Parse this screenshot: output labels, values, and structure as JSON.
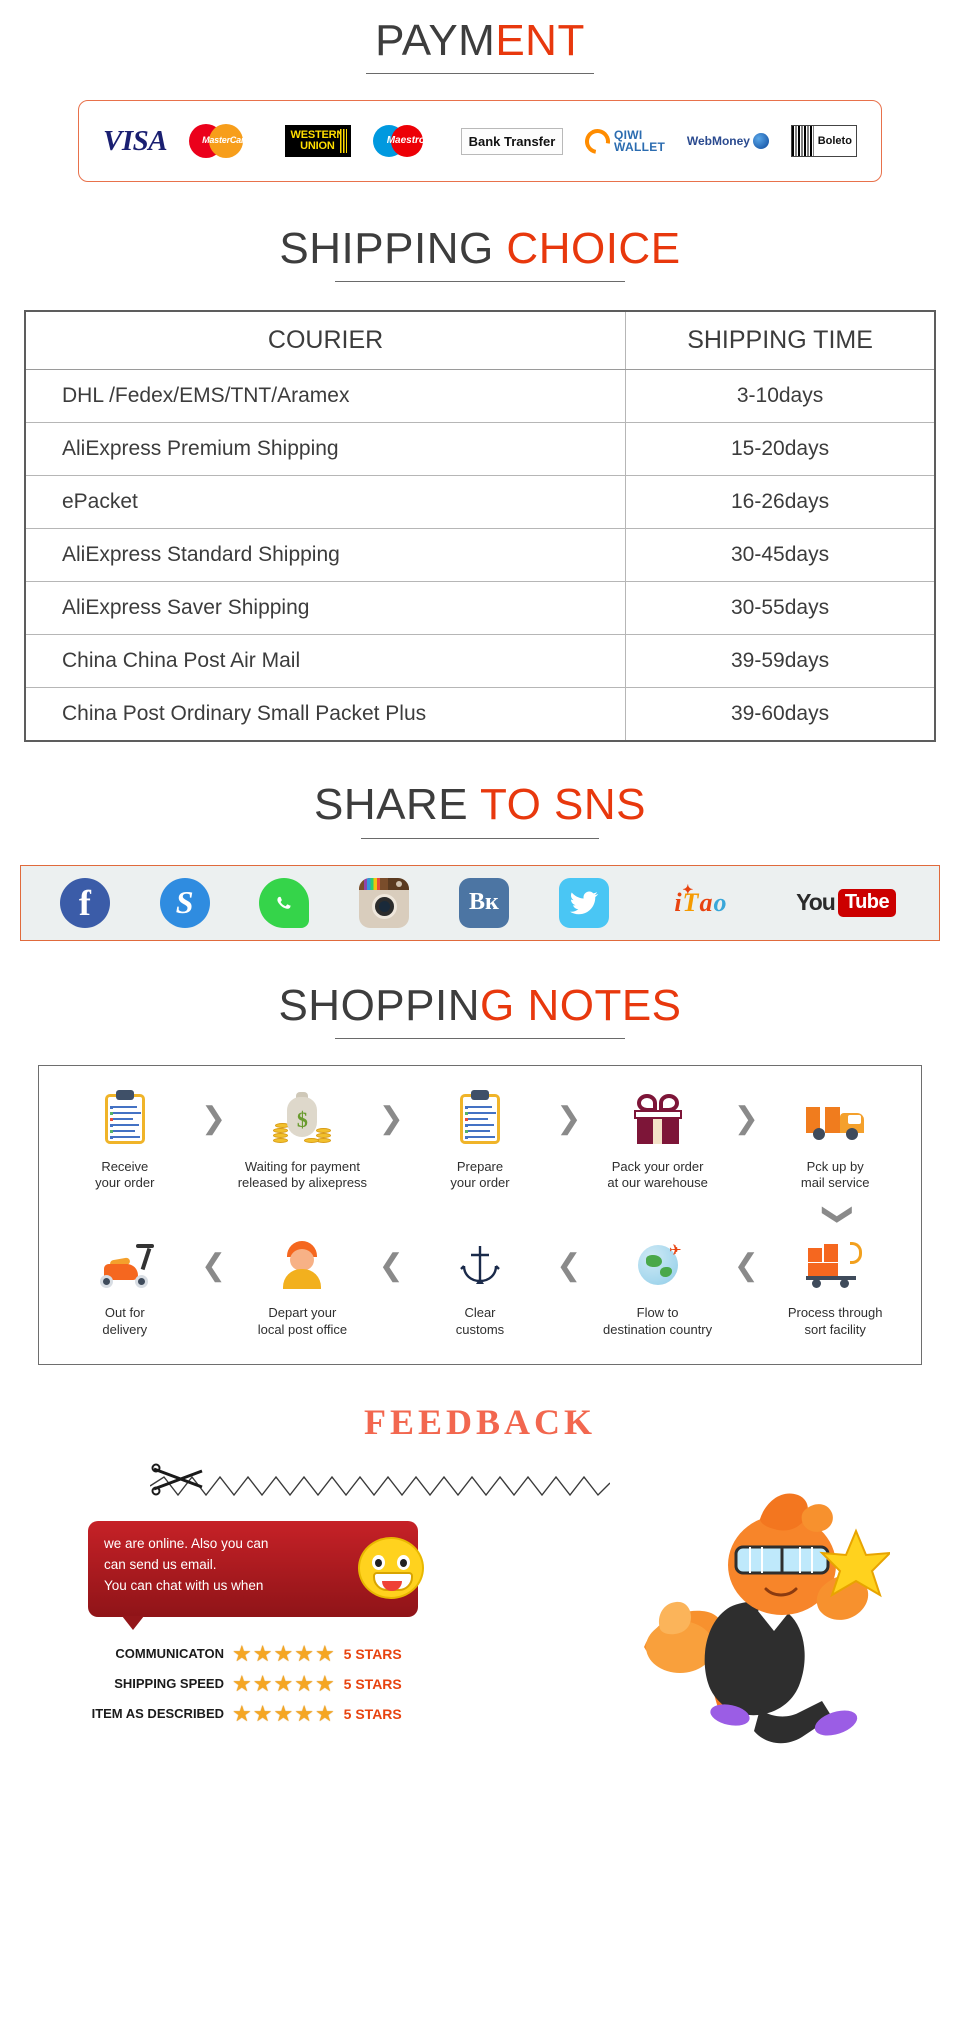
{
  "payment": {
    "heading_dark": "PAYM",
    "heading_red": "ENT",
    "methods": [
      {
        "name": "visa",
        "label": "VISA"
      },
      {
        "name": "mastercard",
        "label": "MasterCard"
      },
      {
        "name": "western-union",
        "label_line1": "WESTERN",
        "label_line2": "UNION"
      },
      {
        "name": "maestro",
        "label": "Maestro"
      },
      {
        "name": "bank-transfer",
        "label": "Bank Transfer"
      },
      {
        "name": "qiwi-wallet",
        "label_line1": "QIWI",
        "label_line2": "WALLET"
      },
      {
        "name": "webmoney",
        "label": "WebMoney"
      },
      {
        "name": "boleto",
        "label": "Boleto"
      }
    ]
  },
  "shipping": {
    "heading_dark": "SHIPPING",
    "heading_red": " CHOICE",
    "columns": [
      "COURIER",
      "SHIPPING TIME"
    ],
    "rows": [
      {
        "courier": "DHL /Fedex/EMS/TNT/Aramex",
        "time": "3-10days"
      },
      {
        "courier": "AliExpress Premium Shipping",
        "time": "15-20days"
      },
      {
        "courier": "ePacket",
        "time": "16-26days"
      },
      {
        "courier": "AliExpress Standard Shipping",
        "time": "30-45days"
      },
      {
        "courier": "AliExpress Saver Shipping",
        "time": "30-55days"
      },
      {
        "courier": "China China Post Air Mail",
        "time": "39-59days"
      },
      {
        "courier": "China Post Ordinary Small Packet Plus",
        "time": "39-60days"
      }
    ]
  },
  "sns": {
    "heading_dark": "SHARE",
    "heading_red": " TO SNS",
    "networks": [
      {
        "name": "facebook",
        "label": "f"
      },
      {
        "name": "skype",
        "label": "S"
      },
      {
        "name": "whatsapp",
        "label": "WhatsApp"
      },
      {
        "name": "instagram",
        "label": "Instagram"
      },
      {
        "name": "vk",
        "label": "VK"
      },
      {
        "name": "twitter",
        "label": "Twitter"
      },
      {
        "name": "itao",
        "label": "iTao"
      },
      {
        "name": "youtube",
        "label_text": "You",
        "label_box": "Tube"
      }
    ]
  },
  "notes": {
    "heading_dark": "SHOPPIN",
    "heading_red": "G NOTES",
    "row1": [
      {
        "icon": "clipboard-icon",
        "line1": "Receive",
        "line2": "your order"
      },
      {
        "icon": "money-bag-icon",
        "line1": "Waiting for payment",
        "line2": "released by alixepress"
      },
      {
        "icon": "clipboard-icon",
        "line1": "Prepare",
        "line2": "your order"
      },
      {
        "icon": "gift-box-icon",
        "line1": "Pack your order",
        "line2": "at our warehouse"
      },
      {
        "icon": "delivery-truck-icon",
        "line1": "Pck up by",
        "line2": "mail service"
      }
    ],
    "row2": [
      {
        "icon": "scooter-icon",
        "line1": "Out for",
        "line2": "delivery"
      },
      {
        "icon": "postal-worker-icon",
        "line1": "Depart your",
        "line2": "local post office"
      },
      {
        "icon": "anchor-icon",
        "line1": "Clear",
        "line2": "customs"
      },
      {
        "icon": "globe-airplane-icon",
        "line1": "Flow to",
        "line2": "destination country"
      },
      {
        "icon": "sorting-cart-icon",
        "line1": "Process through",
        "line2": "sort facility"
      }
    ],
    "arrow_forward": "❯",
    "arrow_back": "❮",
    "arrow_down": "❯"
  },
  "feedback": {
    "heading": "FEEDBACK",
    "chat_lines": [
      "we are online. Also you can",
      "can send us email.",
      "You can chat with us when"
    ],
    "ratings": [
      {
        "label": "COMMUNICATON",
        "stars": 5,
        "value": "5 STARS"
      },
      {
        "label": "SHIPPING SPEED",
        "stars": 5,
        "value": "5 STARS"
      },
      {
        "label": "ITEM AS DESCRIBED",
        "stars": 5,
        "value": "5 STARS"
      }
    ],
    "star_glyph": "★"
  },
  "colors": {
    "accent_red": "#e8380d",
    "heading_dark": "#3d3d3d",
    "border_orange": "#e8714b",
    "sns_bg": "#ecf0f0",
    "star_gold": "#f5a623"
  }
}
